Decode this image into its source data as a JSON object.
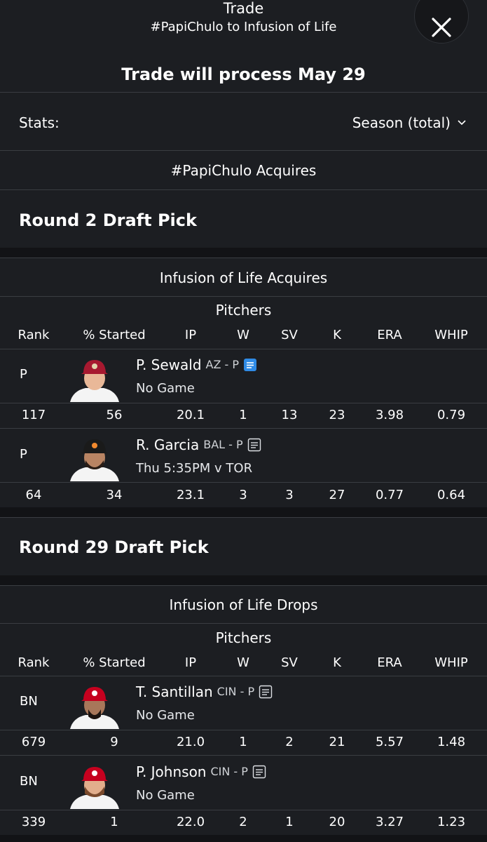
{
  "header": {
    "title": "Trade",
    "subtitle": "#PapiChulo to Infusion of Life",
    "process_text": "Trade will process May 29"
  },
  "stats": {
    "label": "Stats:",
    "selected": "Season (total)"
  },
  "sections": {
    "papichulo_acquires": "#PapiChulo Acquires",
    "pick1": "Round 2 Draft Pick",
    "infusion_acquires": "Infusion of Life Acquires",
    "pick2": "Round 29 Draft Pick",
    "infusion_drops": "Infusion of Life Drops"
  },
  "columns": {
    "group": "Pitchers",
    "rank": "Rank",
    "started": "% Started",
    "ip": "IP",
    "w": "W",
    "sv": "SV",
    "k": "K",
    "era": "ERA",
    "whip": "WHIP"
  },
  "players": [
    {
      "pos": "P",
      "name": "P. Sewald",
      "team": "AZ - P",
      "game": "No Game",
      "note_icon": "note-active",
      "rank": "117",
      "started": "56",
      "ip": "20.1",
      "w": "1",
      "sv": "13",
      "k": "23",
      "era": "3.98",
      "whip": "0.79",
      "cap_color": "#a71930"
    },
    {
      "pos": "P",
      "name": "R. Garcia",
      "team": "BAL - P",
      "game": "Thu 5:35PM v TOR",
      "note_icon": "note",
      "rank": "64",
      "started": "34",
      "ip": "23.1",
      "w": "3",
      "sv": "3",
      "k": "27",
      "era": "0.77",
      "whip": "0.64",
      "cap_color": "#1a1a1a"
    },
    {
      "pos": "BN",
      "name": "T. Santillan",
      "team": "CIN - P",
      "game": "No Game",
      "note_icon": "note",
      "rank": "679",
      "started": "9",
      "ip": "21.0",
      "w": "1",
      "sv": "2",
      "k": "21",
      "era": "5.57",
      "whip": "1.48",
      "cap_color": "#c6011f"
    },
    {
      "pos": "BN",
      "name": "P. Johnson",
      "team": "CIN - P",
      "game": "No Game",
      "note_icon": "note",
      "rank": "339",
      "started": "1",
      "ip": "22.0",
      "w": "2",
      "sv": "1",
      "k": "20",
      "era": "3.27",
      "whip": "1.23",
      "cap_color": "#c6011f"
    }
  ]
}
